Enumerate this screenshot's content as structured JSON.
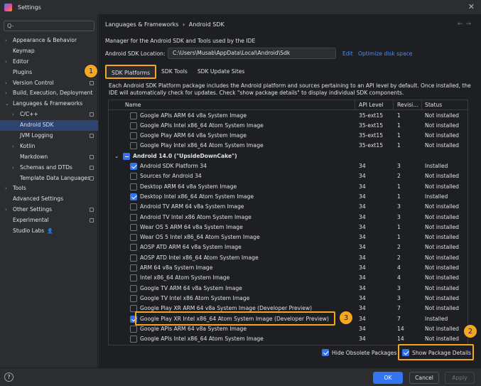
{
  "window": {
    "title": "Settings"
  },
  "sidebar": {
    "search_placeholder": "Q-",
    "items": [
      {
        "label": "Appearance & Behavior",
        "arrow": "›"
      },
      {
        "label": "Keymap",
        "arrow": ""
      },
      {
        "label": "Editor",
        "arrow": "›"
      },
      {
        "label": "Plugins",
        "arrow": ""
      },
      {
        "label": "Version Control",
        "arrow": "›"
      },
      {
        "label": "Build, Execution, Deployment",
        "arrow": "›"
      },
      {
        "label": "Languages & Frameworks",
        "arrow": "⌄"
      },
      {
        "label": "C/C++",
        "arrow": "›"
      },
      {
        "label": "Android SDK",
        "arrow": ""
      },
      {
        "label": "JVM Logging",
        "arrow": ""
      },
      {
        "label": "Kotlin",
        "arrow": "›"
      },
      {
        "label": "Markdown",
        "arrow": ""
      },
      {
        "label": "Schemas and DTDs",
        "arrow": "›"
      },
      {
        "label": "Template Data Languages",
        "arrow": ""
      },
      {
        "label": "Tools",
        "arrow": "›"
      },
      {
        "label": "Advanced Settings",
        "arrow": ""
      },
      {
        "label": "Other Settings",
        "arrow": "›"
      },
      {
        "label": "Experimental",
        "arrow": ""
      },
      {
        "label": "Studio Labs",
        "arrow": ""
      }
    ]
  },
  "breadcrumb": {
    "parent": "Languages & Frameworks",
    "sep": "›",
    "current": "Android SDK"
  },
  "nav": {
    "back": "←",
    "forward": "→"
  },
  "manager_desc": "Manager for the Android SDK and Tools used by the IDE",
  "location": {
    "label": "Android SDK Location:",
    "value": "C:\\Users\\Musab\\AppData\\Local\\Android\\Sdk",
    "edit": "Edit",
    "optimize": "Optimize disk space"
  },
  "tabs": [
    "SDK Platforms",
    "SDK Tools",
    "SDK Update Sites"
  ],
  "info_line1": "Each Android SDK Platform package includes the Android platform and sources pertaining to an API level by default. Once installed, the",
  "info_line2": "IDE will automatically check for updates. Check \"show package details\" to display individual SDK components.",
  "table": {
    "headers": [
      "Name",
      "API Level",
      "Revisi...",
      "Status"
    ],
    "rows": [
      {
        "name": "Google APIs ARM 64 v8a System Image",
        "api": "35-ext15",
        "rev": "1",
        "status": "Not installed",
        "checked": false
      },
      {
        "name": "Google APIs Intel x86_64 Atom System Image",
        "api": "35-ext15",
        "rev": "1",
        "status": "Not installed",
        "checked": false
      },
      {
        "name": "Google Play ARM 64 v8a System Image",
        "api": "35-ext15",
        "rev": "1",
        "status": "Not installed",
        "checked": false
      },
      {
        "name": "Google Play Intel x86_64 Atom System Image",
        "api": "35-ext15",
        "rev": "1",
        "status": "Not installed",
        "checked": false
      },
      {
        "group": true,
        "name": "Android 14.0 (\"UpsideDownCake\")"
      },
      {
        "name": "Android SDK Platform 34",
        "api": "34",
        "rev": "3",
        "status": "Installed",
        "checked": true
      },
      {
        "name": "Sources for Android 34",
        "api": "34",
        "rev": "2",
        "status": "Not installed",
        "checked": false
      },
      {
        "name": "Desktop ARM 64 v8a System Image",
        "api": "34",
        "rev": "1",
        "status": "Not installed",
        "checked": false
      },
      {
        "name": "Desktop Intel x86_64 Atom System Image",
        "api": "34",
        "rev": "1",
        "status": "Installed",
        "checked": true
      },
      {
        "name": "Android TV ARM 64 v8a System Image",
        "api": "34",
        "rev": "3",
        "status": "Not installed",
        "checked": false
      },
      {
        "name": "Android TV Intel x86 Atom System Image",
        "api": "34",
        "rev": "3",
        "status": "Not installed",
        "checked": false
      },
      {
        "name": "Wear OS 5 ARM 64 v8a System Image",
        "api": "34",
        "rev": "1",
        "status": "Not installed",
        "checked": false
      },
      {
        "name": "Wear OS 5 Intel x86_64 Atom System Image",
        "api": "34",
        "rev": "1",
        "status": "Not installed",
        "checked": false
      },
      {
        "name": "AOSP ATD ARM 64 v8a System Image",
        "api": "34",
        "rev": "2",
        "status": "Not installed",
        "checked": false
      },
      {
        "name": "AOSP ATD Intel x86_64 Atom System Image",
        "api": "34",
        "rev": "2",
        "status": "Not installed",
        "checked": false
      },
      {
        "name": "ARM 64 v8a System Image",
        "api": "34",
        "rev": "4",
        "status": "Not installed",
        "checked": false
      },
      {
        "name": "Intel x86_64 Atom System Image",
        "api": "34",
        "rev": "4",
        "status": "Not installed",
        "checked": false
      },
      {
        "name": "Google TV ARM 64 v8a System Image",
        "api": "34",
        "rev": "3",
        "status": "Not installed",
        "checked": false
      },
      {
        "name": "Google TV Intel x86 Atom System Image",
        "api": "34",
        "rev": "3",
        "status": "Not installed",
        "checked": false
      },
      {
        "name": "Google Play XR ARM 64 v8a System Image (Developer Preview)",
        "api": "34",
        "rev": "7",
        "status": "Not installed",
        "checked": false
      },
      {
        "name": "Google Play XR Intel x86_64 Atom System Image (Developer Preview)",
        "api": "34",
        "rev": "7",
        "status": "Installed",
        "checked": true
      },
      {
        "name": "Google APIs ARM 64 v8a System Image",
        "api": "34",
        "rev": "14",
        "status": "Not installed",
        "checked": false
      },
      {
        "name": "Google APIs Intel x86_64 Atom System Image",
        "api": "34",
        "rev": "14",
        "status": "Not installed",
        "checked": false
      }
    ]
  },
  "options": {
    "hide_obsolete": "Hide Obsolete Packages",
    "show_details": "Show Package Details"
  },
  "footer": {
    "help": "?",
    "ok": "OK",
    "cancel": "Cancel",
    "apply": "Apply"
  },
  "badges": [
    "1",
    "2",
    "3"
  ],
  "colors": {
    "accent": "#3574f0",
    "highlight": "#f5a623",
    "link": "#548af7"
  }
}
